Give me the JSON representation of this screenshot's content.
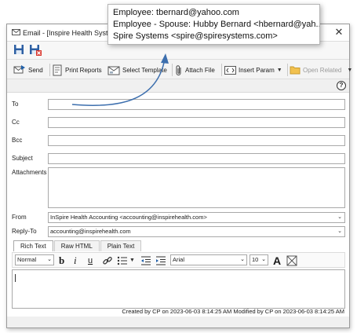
{
  "window": {
    "title": "Email - [Inspire Health Syste",
    "close_glyph": "✕"
  },
  "toolbar": {
    "send": "Send",
    "print_reports": "Print Reports",
    "select_template": "Select Template",
    "attach_file": "Attach File",
    "insert_param": "Insert Param",
    "open_related": "Open Related"
  },
  "help": {
    "glyph": "?"
  },
  "fields": {
    "to_label": "To",
    "cc_label": "Cc",
    "bcc_label": "Bcc",
    "subject_label": "Subject",
    "attachments_label": "Attachments",
    "from_label": "From",
    "from_value": "InSpire Health Accounting <accounting@inspirehealth.com>",
    "reply_to_label": "Reply-To",
    "reply_to_value": "accounting@inspirehealth.com"
  },
  "tabs": [
    "Rich Text",
    "Raw HTML",
    "Plain Text"
  ],
  "editor": {
    "style": "Normal",
    "font": "Arial",
    "size": "10"
  },
  "status": "Created by CP on 2023-06-03 8:14:25 AM  Modified by CP on 2023-06-03 8:14:25 AM",
  "tooltip": {
    "lines": [
      "Employee: tbernard@yahoo.com",
      "Employee - Spouse: Hubby Bernard <hbernard@yah...",
      "Spire Systems <spire@spiresystems.com>"
    ]
  },
  "colors": {
    "accent": "#1f5fa8",
    "arrow": "#3d6fae",
    "folder": "#f2c14e"
  }
}
